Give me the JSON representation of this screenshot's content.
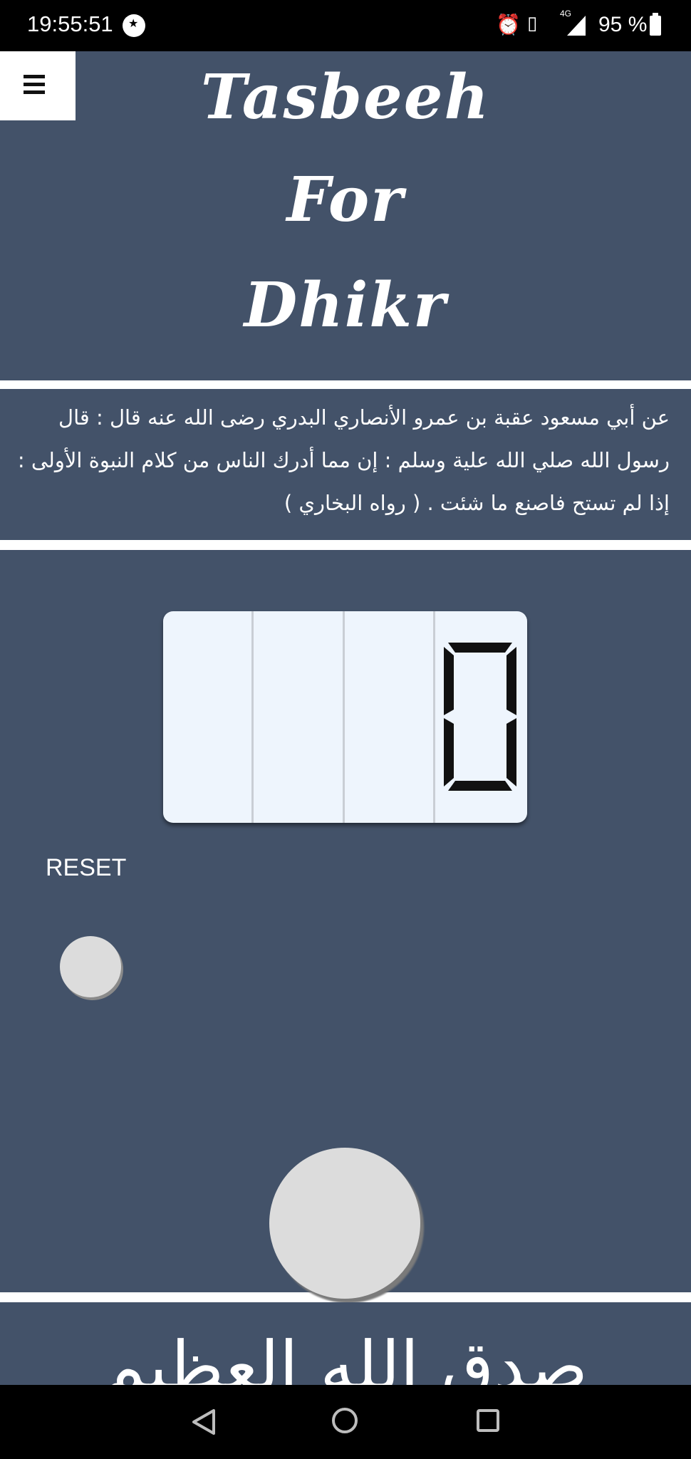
{
  "status_bar": {
    "time": "19:55:51",
    "network": "4G",
    "battery_percent": "95 %",
    "icons": [
      "alarm-icon",
      "vibrate-icon",
      "signal-icon",
      "battery-icon"
    ]
  },
  "header": {
    "title_line1": "Tasbeeh",
    "title_line2": "For",
    "title_line3": "Dhikr",
    "menu_icon": "hamburger-menu-icon"
  },
  "hadith": {
    "text": "عن أبي مسعود عقبة بن عمرو الأنصاري البدري رضى الله عنه قال : قال رسول الله صلي الله علية وسلم : إن مما أدرك الناس من كلام النبوة الأولى : إذا لم تستح فاصنع ما شئت . ( رواه البخاري )"
  },
  "counter": {
    "value": 0,
    "reset_label": "RESET"
  },
  "bottom": {
    "partial_text": "صدق الله العظيم"
  },
  "colors": {
    "background": "#435269",
    "display": "#eef5fd",
    "button": "#dcdcdc"
  },
  "nav_icons": [
    "back-icon",
    "home-icon",
    "recent-apps-icon"
  ]
}
